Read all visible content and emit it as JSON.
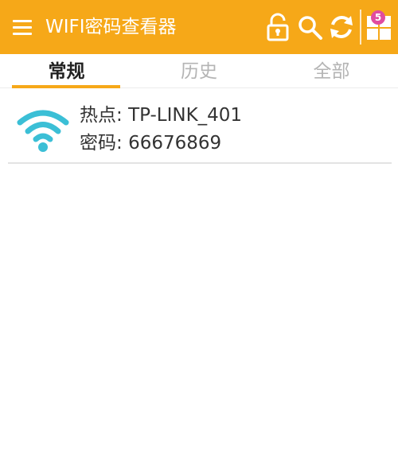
{
  "app_bar": {
    "title": "WIFI密码查看器",
    "icons": [
      "menu-icon",
      "unlock-icon",
      "search-icon",
      "refresh-icon",
      "apps-grid-icon"
    ],
    "badge_count": "5",
    "color": "#F6A818"
  },
  "tabs": [
    {
      "label": "常规",
      "active": true
    },
    {
      "label": "历史",
      "active": false
    },
    {
      "label": "全部",
      "active": false
    }
  ],
  "networks": [
    {
      "hotspot_label": "热点",
      "hotspot_value": "TP-LINK_401",
      "password_label": "密码",
      "password_value": "66676869",
      "icon": "wifi-icon",
      "icon_color": "#3BBFD6"
    }
  ]
}
